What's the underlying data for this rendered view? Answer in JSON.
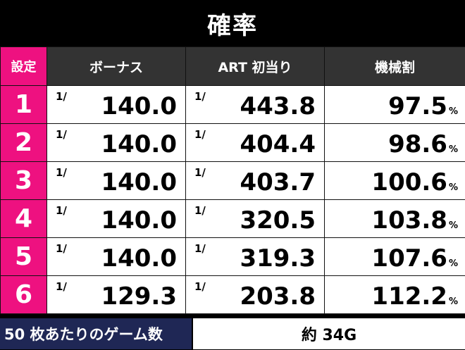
{
  "title": "確率",
  "headers": {
    "setting": "設定",
    "bonus": "ボーナス",
    "art": "ART 初当り",
    "payout": "機械割"
  },
  "fraction_prefix": "1/",
  "percent_unit": "%",
  "rows": [
    {
      "setting": "1",
      "bonus": "140.0",
      "art": "443.8",
      "payout": "97.5"
    },
    {
      "setting": "2",
      "bonus": "140.0",
      "art": "404.4",
      "payout": "98.6"
    },
    {
      "setting": "3",
      "bonus": "140.0",
      "art": "403.7",
      "payout": "100.6"
    },
    {
      "setting": "4",
      "bonus": "140.0",
      "art": "320.5",
      "payout": "103.8"
    },
    {
      "setting": "5",
      "bonus": "140.0",
      "art": "319.3",
      "payout": "107.6"
    },
    {
      "setting": "6",
      "bonus": "129.3",
      "art": "203.8",
      "payout": "112.2"
    }
  ],
  "footer": {
    "label": "50 枚あたりのゲーム数",
    "value": "約 34G"
  },
  "colors": {
    "setting_accent": "#ee1180",
    "header_bg": "#333333",
    "footer_label_bg": "#1f2755"
  }
}
